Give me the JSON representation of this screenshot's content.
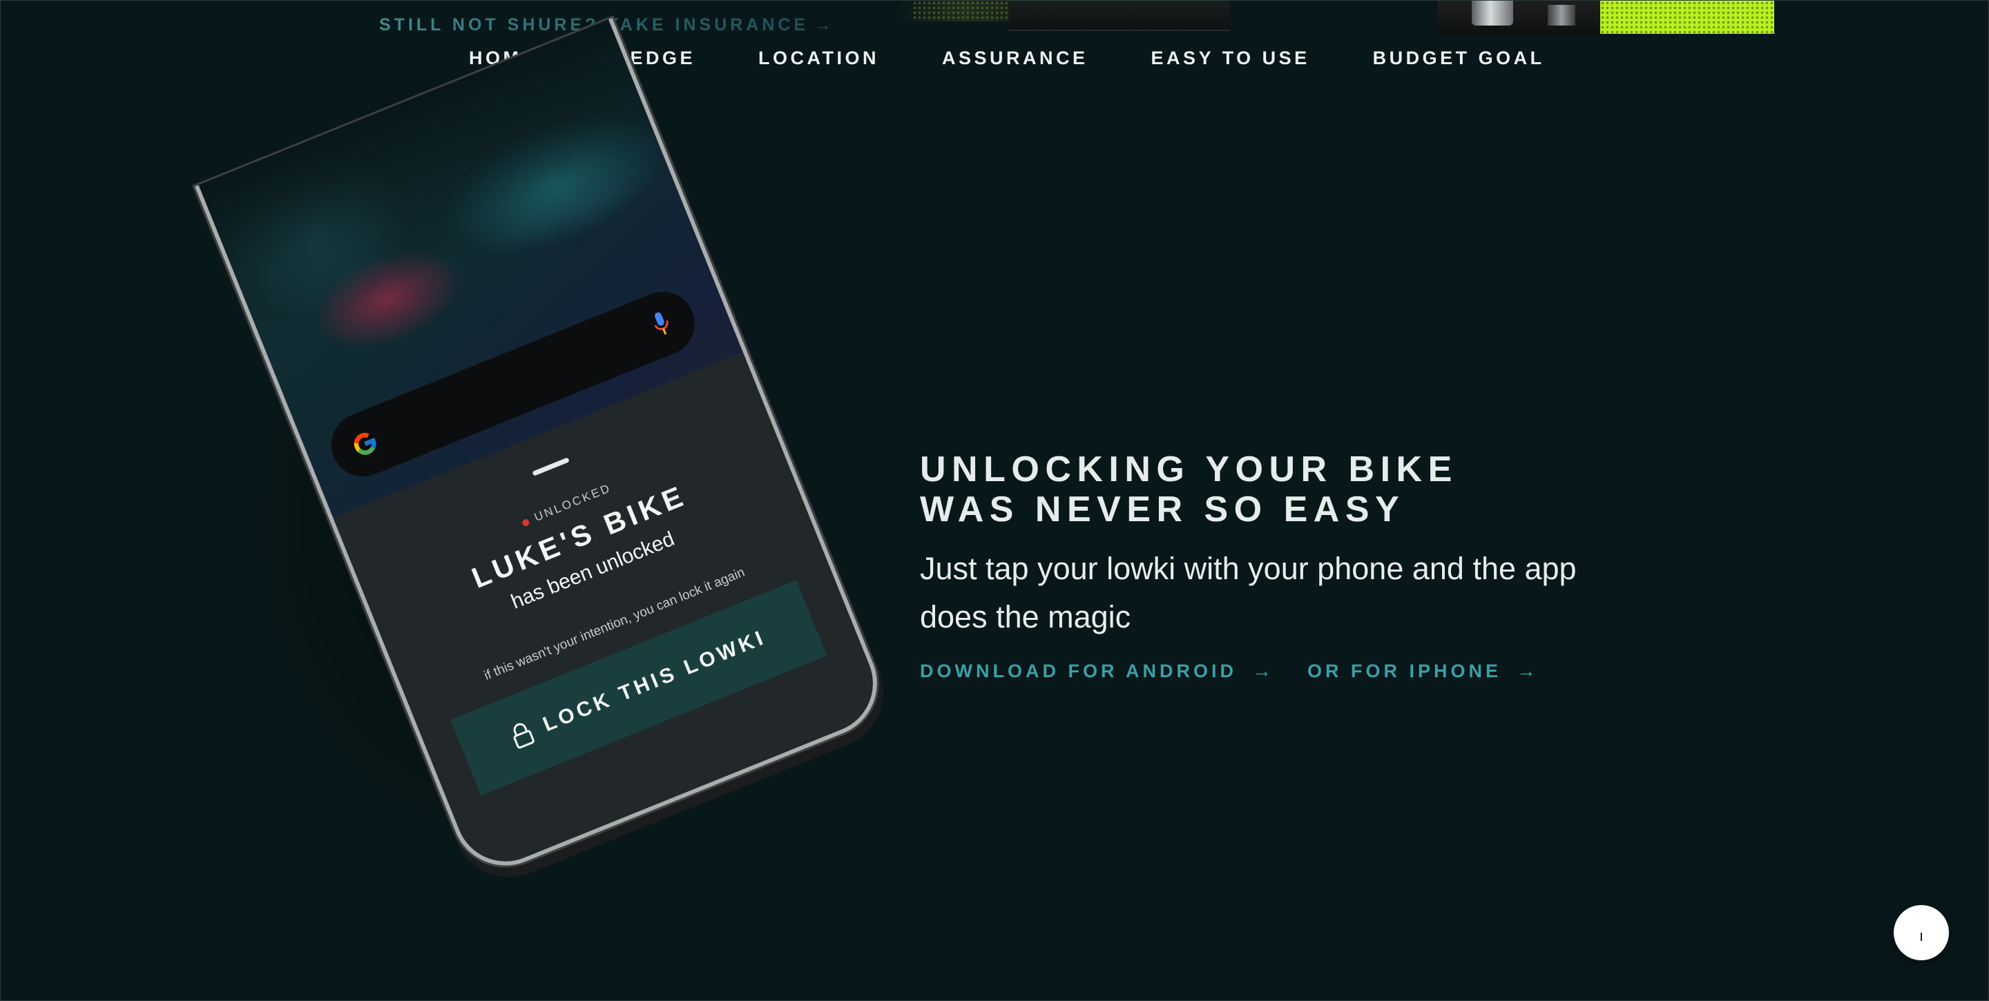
{
  "top_banner": {
    "insurance_link": "STILL NOT SHURE? TAKE INSURANCE",
    "insurance_arrow": "→"
  },
  "nav": {
    "items": [
      "HOME",
      "PLEDGE",
      "LOCATION",
      "ASSURANCE",
      "EASY TO USE",
      "BUDGET GOAL"
    ]
  },
  "phone": {
    "status": "UNLOCKED",
    "bike_name": "LUKE'S BIKE",
    "message": "has been unlocked",
    "hint": "if this wasn't your intention, you can lock it again",
    "lock_button": "LOCK THIS LOWKI",
    "status_color": "#d23b2a"
  },
  "hero": {
    "headline_line1": "UNLOCKING YOUR BIKE",
    "headline_line2": "WAS NEVER SO EASY",
    "subtext": "Just tap your lowki with your phone and the app does the magic",
    "cta_android": "DOWNLOAD FOR ANDROID",
    "cta_iphone": "OR FOR IPHONE",
    "cta_arrow": "→"
  },
  "chat_widget": {
    "label": "ı"
  },
  "colors": {
    "background": "#081719",
    "accent": "#3ba0a6",
    "button": "#1a3e3e",
    "lime": "#b8f020"
  },
  "icons": [
    "google-g-icon",
    "microphone-icon",
    "padlock-icon",
    "arrow-right-icon",
    "chat-icon"
  ]
}
